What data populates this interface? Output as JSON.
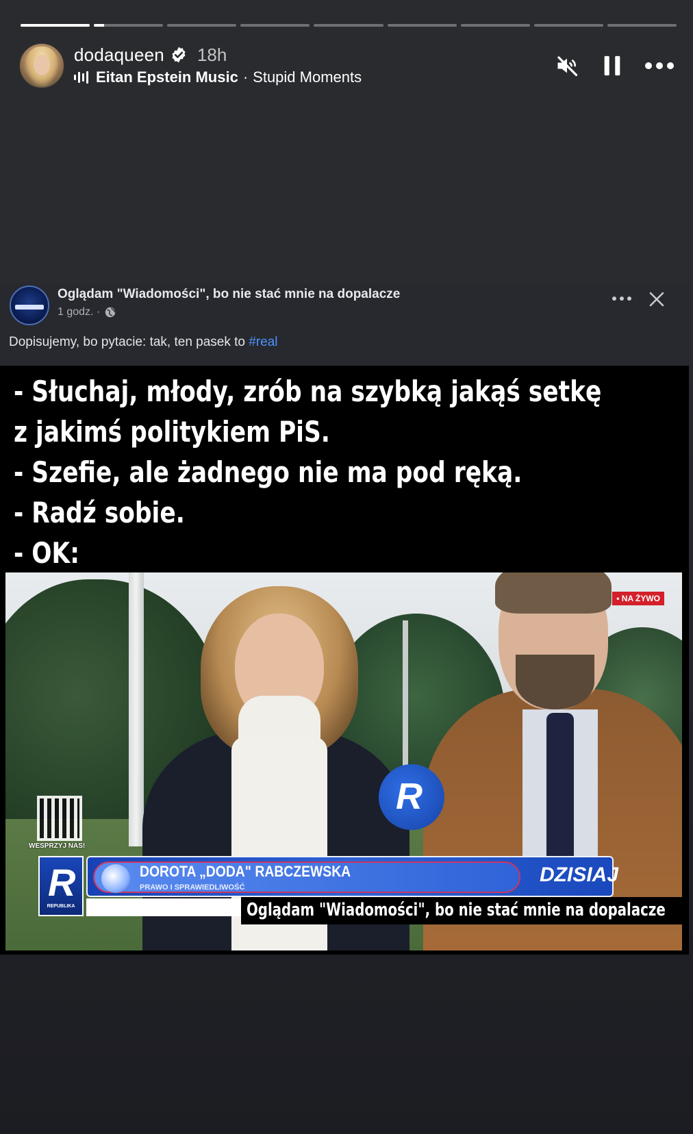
{
  "story": {
    "progress": [
      1.0,
      0.15,
      0,
      0,
      0,
      0,
      0,
      0,
      0
    ],
    "username": "dodaqueen",
    "verified_icon": "verified-badge-icon",
    "time": "18h",
    "music": {
      "artist": "Eitan Epstein Music",
      "separator": "·",
      "song": "Stupid Moments"
    },
    "controls": [
      "muted-speaker-icon",
      "pause-icon",
      "more-icon"
    ]
  },
  "post": {
    "page_name": "Oglądam \"Wiadomości\", bo nie stać mnie na dopalacze",
    "time": "1 godz. ·",
    "caption": "Dopisujemy, bo pytacie: tak, ten pasek to ",
    "hashtag": "#real"
  },
  "meme": {
    "lines": [
      "- Słuchaj, młody, zrób na szybką jakąś setkę",
      "z jakimś politykiem PiS.",
      "- Szefie, ale żadnego nie ma pod ręką.",
      "- Radź sobie.",
      "- OK:"
    ]
  },
  "tv": {
    "live_badge": "• NA ŻYWO",
    "qr_label": "WESPRZYJ NAS!",
    "logo_letter": "R",
    "logo_sub": "REPUBLIKA",
    "mic_letter": "R",
    "name": "DOROTA „DODA\" RABCZEWSKA",
    "party": "PRAWO I SPRAWIEDLIWOŚĆ",
    "today": "DZISIAJ",
    "ticker": "Oglądam \"Wiadomości\", bo nie stać mnie na dopalacze"
  },
  "colors": {
    "background": "#2a2b2f",
    "hashtag": "#4e93ff",
    "tv_blue": "#1742b5",
    "live_red": "#d3202a"
  }
}
